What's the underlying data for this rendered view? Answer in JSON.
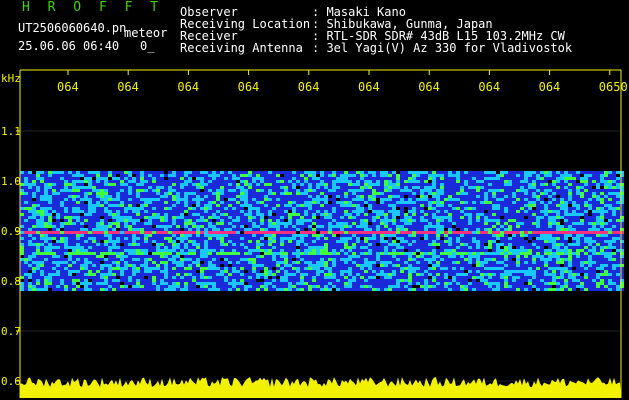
{
  "header": {
    "app_name": "H R O F F T",
    "file_name": "UT2506060640.pn",
    "file_tag": "meteor",
    "timestamp": "25.06.06 06:40",
    "counter": "0_",
    "fields": [
      {
        "label": "Observer",
        "value": ": Masaki Kano"
      },
      {
        "label": "Receiving Location",
        "value": ": Shibukawa, Gunma, Japan"
      },
      {
        "label": "Receiver",
        "value": ": RTL-SDR SDR# 43dB L15 103.2MHz CW"
      },
      {
        "label": "Receiving Antenna",
        "value": ": 3el Yagi(V) Az 330 for Vladivostok"
      }
    ]
  },
  "chart_data": {
    "type": "heatmap",
    "title": "",
    "ylabel": "kHz",
    "xlabel": "",
    "x_tick_labels": [
      "064",
      "064",
      "064",
      "064",
      "064",
      "064",
      "064",
      "064",
      "064",
      "0650"
    ],
    "y_tick_labels": [
      "1.1",
      "1.0",
      "0.9",
      "0.8",
      "0.7",
      "0.6"
    ],
    "ylim": [
      0.6,
      1.13
    ],
    "noise_band_khz": [
      0.78,
      1.02
    ],
    "carrier_khz": 0.9,
    "secondary_line_khz": 0.86,
    "colors": {
      "background": "#000000",
      "noise_low": "#1a2ad8",
      "noise_mid": "#18c8ff",
      "noise_high": "#40ff40",
      "carrier": "#ff3080",
      "level_bar": "#f2f200",
      "axis": "#f2f200",
      "grid": "#8a8a8a"
    }
  }
}
